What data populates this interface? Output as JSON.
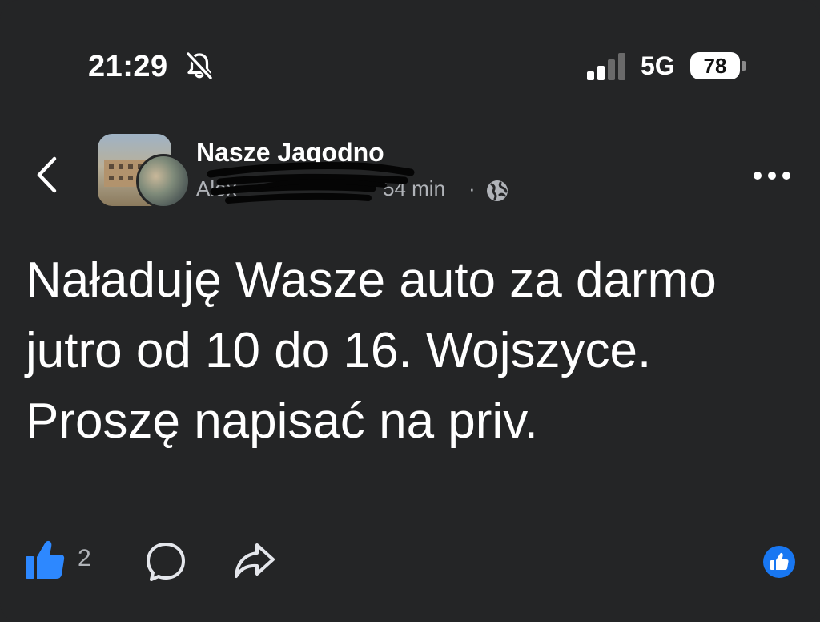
{
  "status_bar": {
    "time": "21:29",
    "network": "5G",
    "battery": "78"
  },
  "post": {
    "group_name": "Nasze Jagodno",
    "author": "Alex",
    "time_ago": "54 min",
    "separator": "·",
    "text": "Naładuję Wasze auto za darmo jutro od 10 do 16. Wojszyce. Proszę napisać na priv.",
    "like_count": "2"
  },
  "colors": {
    "background": "#242526",
    "text_primary": "#ffffff",
    "text_secondary": "#b0b3b8",
    "accent_blue": "#1877f2",
    "like_blue": "#2d88ff"
  },
  "icons": {
    "mute": "bell-slash-icon",
    "signal": "cellular-signal-icon",
    "back": "chevron-left-icon",
    "privacy": "globe-icon",
    "more": "more-dots-icon",
    "like": "thumbs-up-icon",
    "comment": "comment-bubble-icon",
    "share": "share-arrow-icon",
    "reaction": "like-reaction-badge-icon"
  }
}
